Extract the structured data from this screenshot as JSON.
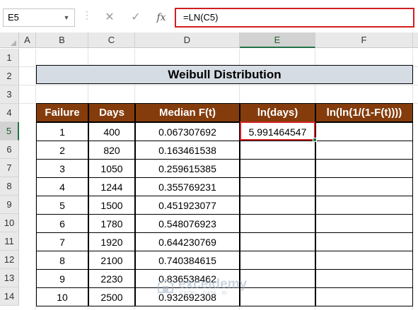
{
  "formula_bar": {
    "name_box": "E5",
    "cancel_icon": "✕",
    "enter_icon": "✓",
    "fx_label": "fx",
    "formula": "=LN(C5)"
  },
  "columns": [
    "A",
    "B",
    "C",
    "D",
    "E",
    "F"
  ],
  "selected_column": "E",
  "rows": [
    "1",
    "2",
    "3",
    "4",
    "5",
    "6",
    "7",
    "8",
    "9",
    "10",
    "11",
    "12",
    "13",
    "14"
  ],
  "selected_row": "5",
  "sheet": {
    "title": "Weibull Distribution",
    "headers": [
      "Failure",
      "Days",
      "Median F(t)",
      "ln(days)",
      "ln(ln(1/(1-F(t))))"
    ],
    "data": [
      [
        "1",
        "400",
        "0.067307692",
        "5.991464547",
        ""
      ],
      [
        "2",
        "820",
        "0.163461538",
        "",
        ""
      ],
      [
        "3",
        "1050",
        "0.259615385",
        "",
        ""
      ],
      [
        "4",
        "1244",
        "0.355769231",
        "",
        ""
      ],
      [
        "5",
        "1500",
        "0.451923077",
        "",
        ""
      ],
      [
        "6",
        "1780",
        "0.548076923",
        "",
        ""
      ],
      [
        "7",
        "1920",
        "0.644230769",
        "",
        ""
      ],
      [
        "8",
        "2100",
        "0.740384615",
        "",
        ""
      ],
      [
        "9",
        "2230",
        "0.836538462",
        "",
        ""
      ],
      [
        "10",
        "2500",
        "0.932692308",
        "",
        ""
      ]
    ]
  },
  "watermark": {
    "name": "exceldemy",
    "tagline": "EXCEL · DATA · BI"
  },
  "colors": {
    "header_fill": "#843c0c",
    "title_fill": "#d6dce4",
    "highlight": "#d11f1f",
    "selection": "#217346"
  }
}
